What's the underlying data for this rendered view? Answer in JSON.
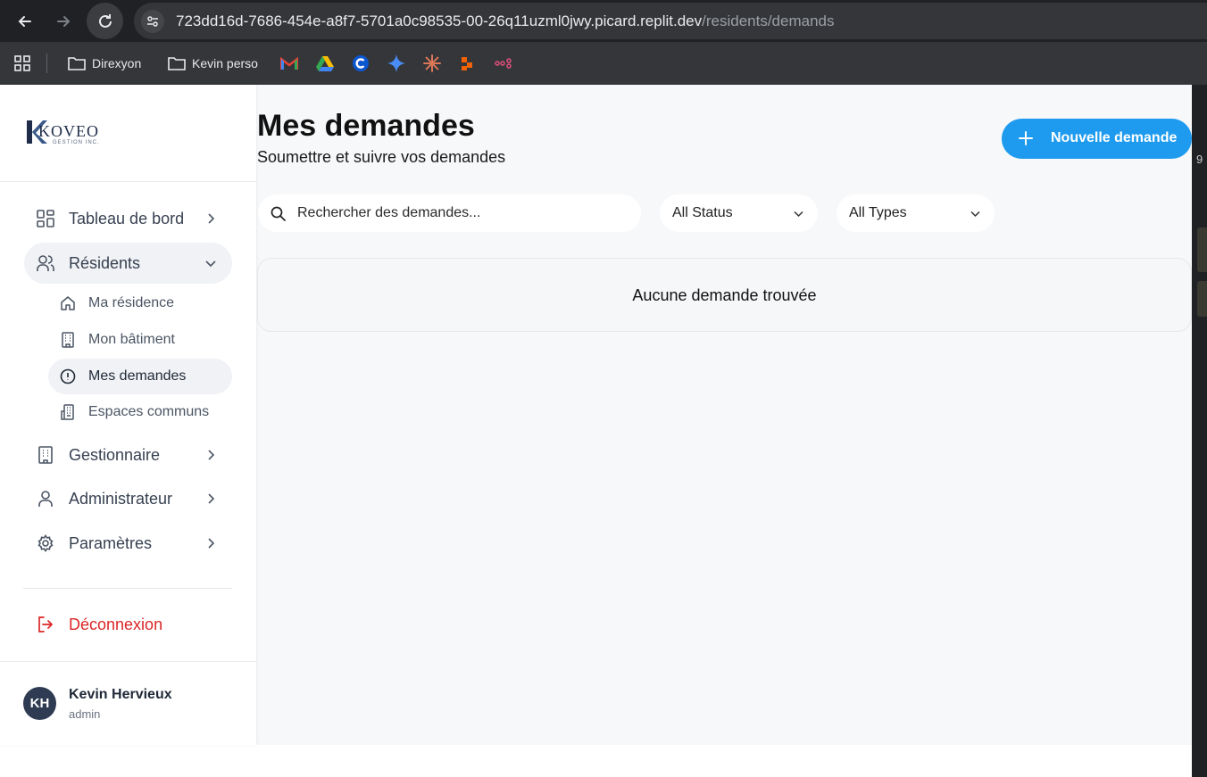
{
  "browser": {
    "url_host": "723dd16d-7686-454e-a8f7-5701a0c98535-00-26q11uzml0jwy.picard.replit.dev",
    "url_path": "/residents/demands",
    "bookmarks": [
      {
        "label": "Direxyon",
        "icon": "folder-icon"
      },
      {
        "label": "Kevin perso",
        "icon": "folder-icon"
      }
    ],
    "bookmark_icons": [
      "gmail-icon",
      "google-drive-icon",
      "c-icon",
      "gemini-icon",
      "claude-icon",
      "app-icon",
      "link-icon"
    ]
  },
  "sidebar": {
    "logo_text": "KOVEO",
    "logo_sub": "GESTION INC.",
    "items": [
      {
        "label": "Tableau de bord",
        "icon": "dashboard-icon"
      },
      {
        "label": "Résidents",
        "icon": "users-icon",
        "expanded": true
      },
      {
        "label": "Gestionnaire",
        "icon": "building-icon"
      },
      {
        "label": "Administrateur",
        "icon": "user-icon"
      },
      {
        "label": "Paramètres",
        "icon": "gear-icon"
      }
    ],
    "sub_items": [
      {
        "label": "Ma résidence",
        "icon": "home-icon"
      },
      {
        "label": "Mon bâtiment",
        "icon": "building-icon"
      },
      {
        "label": "Mes demandes",
        "icon": "alert-circle-icon",
        "active": true
      },
      {
        "label": "Espaces communs",
        "icon": "building-icon"
      }
    ],
    "logout_label": "Déconnexion",
    "user": {
      "initials": "KH",
      "name": "Kevin Hervieux",
      "role": "admin"
    }
  },
  "main": {
    "title": "Mes demandes",
    "subtitle": "Soumettre et suivre vos demandes",
    "new_button_label": "Nouvelle demande",
    "search_placeholder": "Rechercher des demandes...",
    "status_filter": "All Status",
    "type_filter": "All Types",
    "empty_message": "Aucune demande trouvée"
  },
  "devtools": {
    "digit": "9"
  },
  "colors": {
    "accent": "#1e9bef",
    "danger": "#dc2626",
    "avatar": "#2f3b52"
  }
}
